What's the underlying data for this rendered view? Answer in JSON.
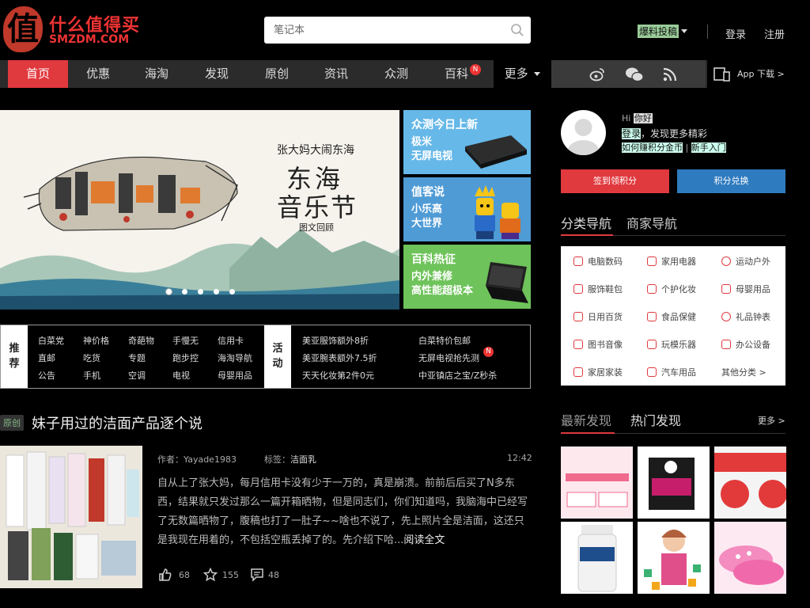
{
  "header": {
    "logo_glyph": "值",
    "logo_cn": "什么值得买",
    "logo_en": "SMZDM.COM",
    "search_placeholder": "笔记本",
    "user_name": "爆料投稿",
    "login": "登录",
    "register": "注册"
  },
  "nav": {
    "items": [
      "首页",
      "优惠",
      "海淘",
      "发现",
      "原创",
      "资讯",
      "众测",
      "百科"
    ],
    "badge": "N",
    "more": "更多",
    "app": "App 下载 >"
  },
  "banner": {
    "line1": "张大妈大闹东海",
    "line2": "东海",
    "line3": "音乐节",
    "line4": "图文回顾",
    "dot_count": 5,
    "active_dot": 0
  },
  "promos": [
    {
      "title": "众测今日上新",
      "sub": "极米\n无屏电视",
      "color": "#66b8e8"
    },
    {
      "title": "值客说",
      "sub": "小乐高\n大世界",
      "color": "#4f9bd6"
    },
    {
      "title": "百科热征",
      "sub": "内外兼修\n高性能超极本",
      "color": "#6ec35a"
    }
  ],
  "recommend": {
    "label": "推荐",
    "rows": [
      [
        "白菜党",
        "神价格",
        "奇葩物",
        "手慢无",
        "信用卡"
      ],
      [
        "直邮",
        "吃货",
        "专题",
        "跑步控",
        "海淘导航"
      ],
      [
        "公告",
        "手机",
        "空调",
        "电视",
        "母婴用品"
      ]
    ]
  },
  "activity": {
    "label": "活动",
    "left": [
      "美亚服饰额外8折",
      "美亚腕表额外7.5折",
      "天天化妆第2件0元"
    ],
    "right": [
      "白菜特价包邮",
      "无屏电视抢先测",
      "中亚镇店之宝/Z秒杀"
    ],
    "badge": "N"
  },
  "article": {
    "tag": "原创",
    "title": "妹子用过的洁面产品逐个说",
    "author_label": "作者：",
    "author": "Yayade1983",
    "tags_label": "标签：",
    "tags": "洁面乳",
    "time": "12:42",
    "body": "自从上了张大妈，每月信用卡没有少于一万的，真是崩溃。前前后后买了N多东西，结果就只发过那么一篇开箱晒物，但是同志们，你们知道吗，我脑海中已经写了无数篇晒物了，腹稿也打了一肚子~~啥也不说了，先上照片全是洁面，这还只是我现在用着的，不包括空瓶丢掉了的。先介绍下哈...",
    "read_more": "阅读全文",
    "likes": "68",
    "favs": "155",
    "comments": "48"
  },
  "sidebar": {
    "hi": "Hi",
    "hi_name": "你好",
    "login_link": "登录",
    "discover": "，发现更多精彩",
    "link1": "如何赚积分金币",
    "link2": "新手入门",
    "sign_btn": "签到领积分",
    "exchange_btn": "积分兑换",
    "tab_category": "分类导航",
    "tab_merchant": "商家导航",
    "categories": [
      "电脑数码",
      "家用电器",
      "运动户外",
      "服饰鞋包",
      "个护化妆",
      "母婴用品",
      "日用百货",
      "食品保健",
      "礼品钟表",
      "图书音像",
      "玩模乐器",
      "办公设备",
      "家居家装",
      "汽车用品",
      "其他分类 >"
    ],
    "disc_new": "最新发现",
    "disc_hot": "热门发现",
    "more": "更多 >"
  },
  "colors": {
    "accent_red": "#e0393e",
    "accent_blue": "#2f7bbf",
    "nav_bg": "#2b2b2b"
  }
}
